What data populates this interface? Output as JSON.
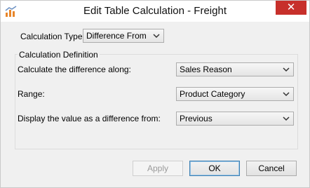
{
  "window": {
    "title": "Edit Table Calculation - Freight",
    "close_glyph": "✕"
  },
  "calc_type": {
    "label": "Calculation Type",
    "value": "Difference From"
  },
  "definition": {
    "legend": "Calculation Definition",
    "along": {
      "label": "Calculate the difference along:",
      "value": "Sales Reason"
    },
    "range": {
      "label": "Range:",
      "value": "Product Category"
    },
    "from": {
      "label": "Display the value as a difference from:",
      "value": "Previous"
    }
  },
  "buttons": {
    "apply": "Apply",
    "ok": "OK",
    "cancel": "Cancel"
  },
  "colors": {
    "close_bg": "#c7302b",
    "accent_border": "#3c7fb1",
    "icon_orange": "#e8862a"
  }
}
